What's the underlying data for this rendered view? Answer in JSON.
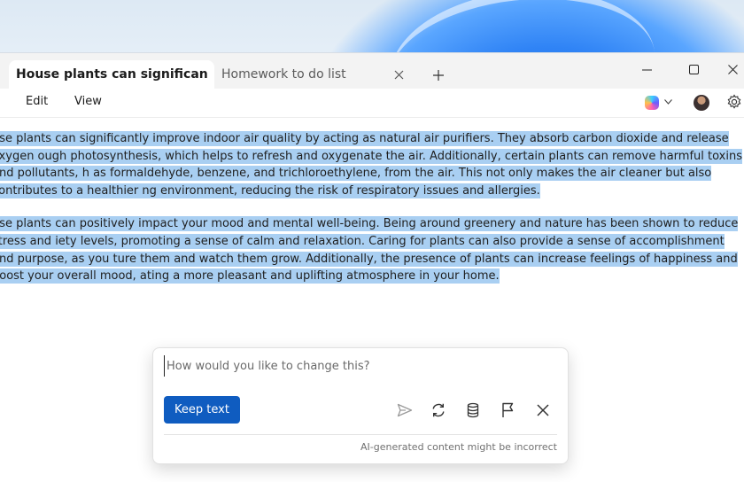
{
  "tabs": [
    {
      "label": "House plants can significan",
      "active": true
    },
    {
      "label": "Homework to do list",
      "active": false
    }
  ],
  "menu": {
    "edit": "Edit",
    "view": "View"
  },
  "document": {
    "paragraphs": [
      "use plants can significantly improve indoor air quality by acting as natural air purifiers. They absorb carbon dioxide and release oxygen ough photosynthesis, which helps to refresh and oxygenate the air. Additionally, certain plants can remove harmful toxins and pollutants, h as formaldehyde, benzene, and trichloroethylene, from the air. This not only makes the air cleaner but also contributes to a healthier ng environment, reducing the risk of respiratory issues and allergies.",
      "use plants can positively impact your mood and mental well-being. Being around greenery and nature has been shown to reduce stress and iety levels, promoting a sense of calm and relaxation. Caring for plants can also provide a sense of accomplishment and purpose, as you ture them and watch them grow. Additionally, the presence of plants can increase feelings of happiness and boost your overall mood, ating a more pleasant and uplifting atmosphere in your home."
    ],
    "highlight_color": "#a9cff2"
  },
  "rewrite_popup": {
    "placeholder": "How would you like to change this?",
    "keep_label": "Keep text",
    "disclaimer": "AI-generated content might be incorrect",
    "actions": [
      "send-icon",
      "regenerate-icon",
      "database-icon",
      "flag-icon",
      "close-icon"
    ],
    "accent": "#0f5cc0"
  },
  "icons": {
    "tab_close": "close-icon",
    "new_tab": "plus-icon",
    "minimize": "minimize-icon",
    "maximize": "maximize-icon",
    "window_close": "close-icon",
    "copilot": "copilot-icon",
    "settings": "gear-icon"
  }
}
